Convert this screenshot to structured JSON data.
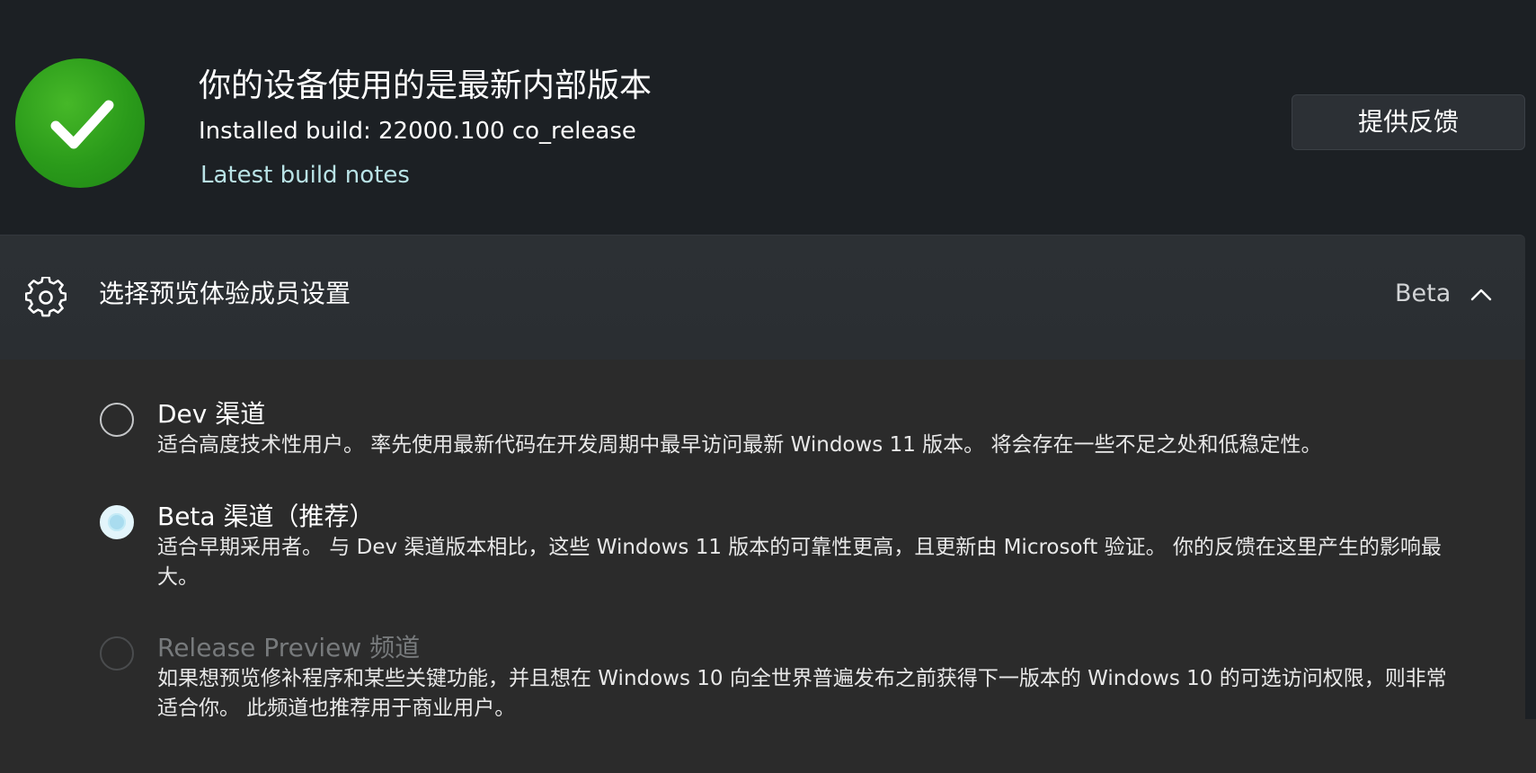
{
  "header": {
    "title": "你的设备使用的是最新内部版本",
    "installed_build": "Installed build: 22000.100 co_release",
    "build_notes_link": "Latest build notes",
    "feedback_button": "提供反馈",
    "status_icon": "checkmark-circle-icon",
    "status_color": "#2a9a1a"
  },
  "settings": {
    "title": "选择预览体验成员设置",
    "current_channel": "Beta",
    "icon": "gear-icon",
    "expanded": true
  },
  "channels": [
    {
      "title": "Dev 渠道",
      "description": "适合高度技术性用户。 率先使用最新代码在开发周期中最早访问最新 Windows 11 版本。 将会存在一些不足之处和低稳定性。",
      "selected": false,
      "enabled": true
    },
    {
      "title": "Beta 渠道（推荐）",
      "description": "适合早期采用者。 与 Dev 渠道版本相比，这些 Windows 11 版本的可靠性更高，且更新由 Microsoft 验证。 你的反馈在这里产生的影响最大。",
      "selected": true,
      "enabled": true
    },
    {
      "title": "Release Preview 频道",
      "description": "如果想预览修补程序和某些关键功能，并且想在 Windows 10 向全世界普遍发布之前获得下一版本的 Windows 10 的可选访问权限，则非常适合你。 此频道也推荐用于商业用户。",
      "selected": false,
      "enabled": false
    }
  ],
  "colors": {
    "accent_link": "#b9e3e6",
    "selected_radio": "#a9dcef",
    "background": "#1c2024",
    "panel": "#2b2b2b"
  }
}
